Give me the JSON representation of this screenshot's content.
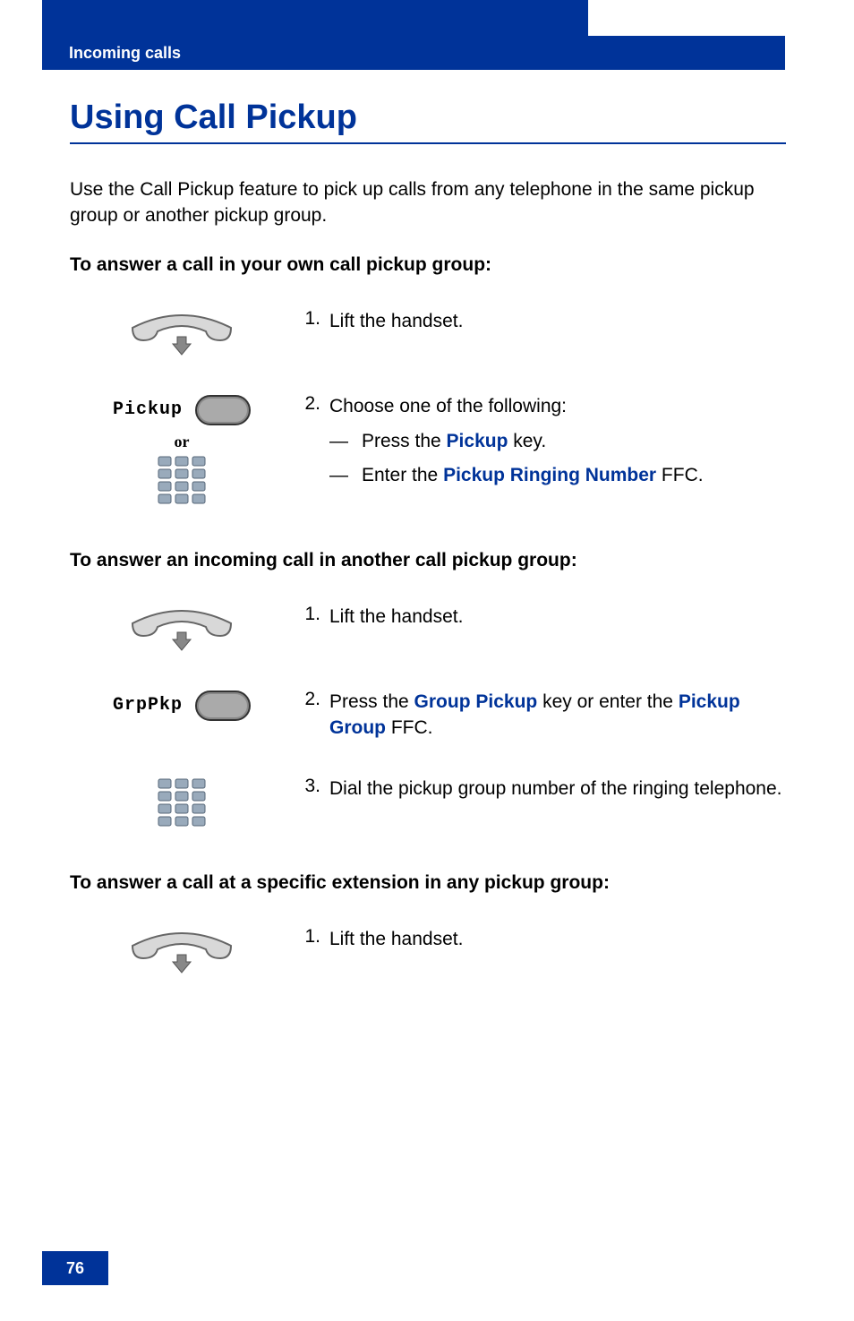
{
  "header": {
    "section": "Incoming calls"
  },
  "title": "Using Call Pickup",
  "intro": "Use the Call Pickup feature to pick up calls from any telephone in the same pickup group or another pickup group.",
  "section1_heading": "To answer a call in your own call pickup group:",
  "s1_step1_num": "1.",
  "s1_step1_text": "Lift the handset.",
  "s1_step2_num": "2.",
  "s1_step2_intro": "Choose one of the following:",
  "s1_step2_dash1": "—",
  "s1_step2_a_pre": "Press the ",
  "s1_step2_a_key": "Pickup",
  "s1_step2_a_post": " key.",
  "s1_step2_dash2": "—",
  "s1_step2_b_pre": "Enter the ",
  "s1_step2_b_key": "Pickup Ringing Number",
  "s1_step2_b_post": " FFC.",
  "s1_key_label": "Pickup",
  "or_text": "or",
  "section2_heading": "To answer an incoming call in another call pickup group:",
  "s2_step1_num": "1.",
  "s2_step1_text": "Lift the handset.",
  "s2_step2_num": "2.",
  "s2_step2_pre": "Press the ",
  "s2_step2_key1": "Group Pickup",
  "s2_step2_mid": " key or enter the ",
  "s2_step2_key2": "Pickup Group",
  "s2_step2_post": " FFC.",
  "s2_key_label": "GrpPkp",
  "s2_step3_num": "3.",
  "s2_step3_text": "Dial the pickup group number of the ringing telephone.",
  "section3_heading": "To answer a call at a specific extension in any pickup group:",
  "s3_step1_num": "1.",
  "s3_step1_text": "Lift the handset.",
  "page_number": "76"
}
